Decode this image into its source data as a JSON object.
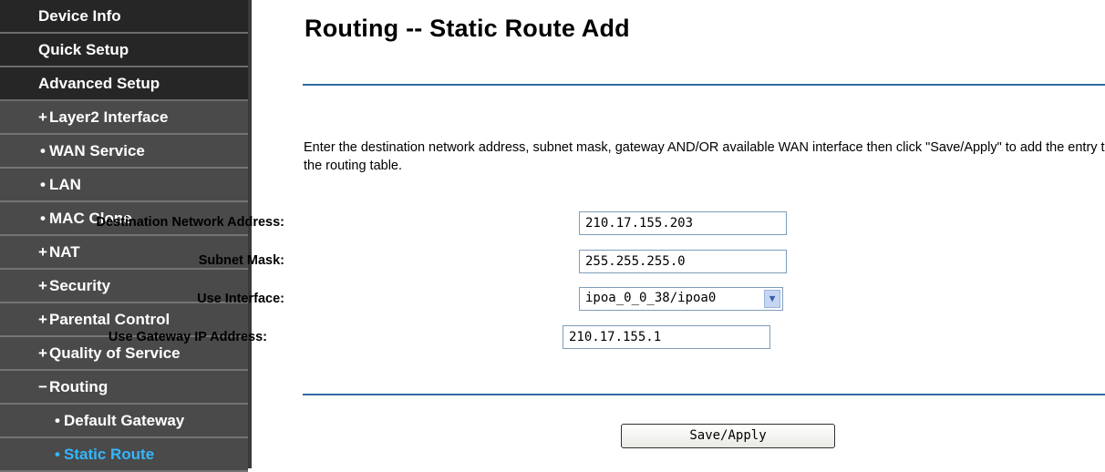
{
  "sidebar": {
    "items": [
      {
        "label": "Device Info",
        "bullet": ""
      },
      {
        "label": "Quick Setup",
        "bullet": ""
      },
      {
        "label": "Advanced Setup",
        "bullet": ""
      },
      {
        "label": "Layer2 Interface",
        "bullet": "+"
      },
      {
        "label": "WAN Service",
        "bullet": "•"
      },
      {
        "label": "LAN",
        "bullet": "•"
      },
      {
        "label": "MAC Clone",
        "bullet": "•"
      },
      {
        "label": "NAT",
        "bullet": "+"
      },
      {
        "label": "Security",
        "bullet": "+"
      },
      {
        "label": "Parental Control",
        "bullet": "+"
      },
      {
        "label": "Quality of Service",
        "bullet": "+"
      },
      {
        "label": "Routing",
        "bullet": "−"
      },
      {
        "label": "Default Gateway",
        "bullet": "•"
      },
      {
        "label": "Static Route",
        "bullet": "•"
      }
    ],
    "active_color": "#34b6ff"
  },
  "page": {
    "title": "Routing -- Static Route Add",
    "description": "Enter the destination network address, subnet mask, gateway AND/OR available WAN interface then click \"Save/Apply\" to add the entry to the routing table."
  },
  "form": {
    "destination_label": "Destination Network Address:",
    "destination_value": "210.17.155.203",
    "subnet_label": "Subnet Mask:",
    "subnet_value": "255.255.255.0",
    "interface_label": "Use Interface:",
    "interface_value": "ipoa_0_0_38/ipoa0",
    "gateway_label": "Use Gateway IP Address:",
    "gateway_value": "210.17.155.1",
    "save_label": "Save/Apply"
  }
}
